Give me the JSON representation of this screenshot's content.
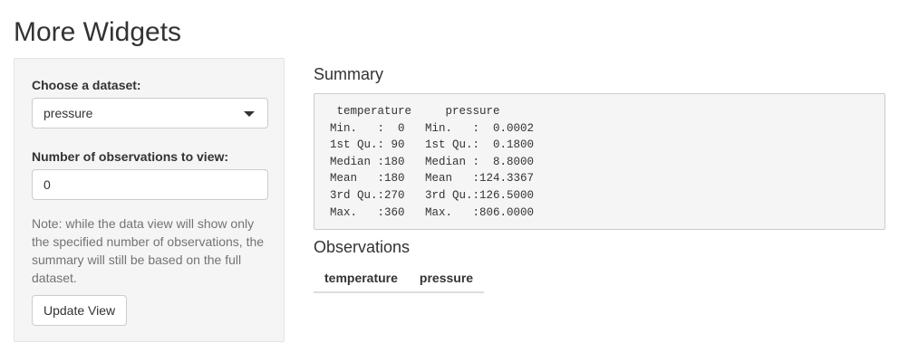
{
  "page": {
    "title": "More Widgets"
  },
  "sidebar": {
    "dataset_label": "Choose a dataset:",
    "dataset_selected": "pressure",
    "obs_label": "Number of observations to view:",
    "obs_value": "0",
    "note": "Note: while the data view will show only the specified number of observations, the summary will still be based on the full dataset.",
    "update_button": "Update View"
  },
  "main": {
    "summary_heading": "Summary",
    "summary_text": " temperature     pressure      \nMin.   :  0   Min.   :  0.0002  \n1st Qu.: 90   1st Qu.:  0.1800  \nMedian :180   Median :  8.8000  \nMean   :180   Mean   :124.3367  \n3rd Qu.:270   3rd Qu.:126.5000  \nMax.   :360   Max.   :806.0000  ",
    "observations_heading": "Observations",
    "table_columns": [
      "temperature",
      "pressure"
    ]
  }
}
